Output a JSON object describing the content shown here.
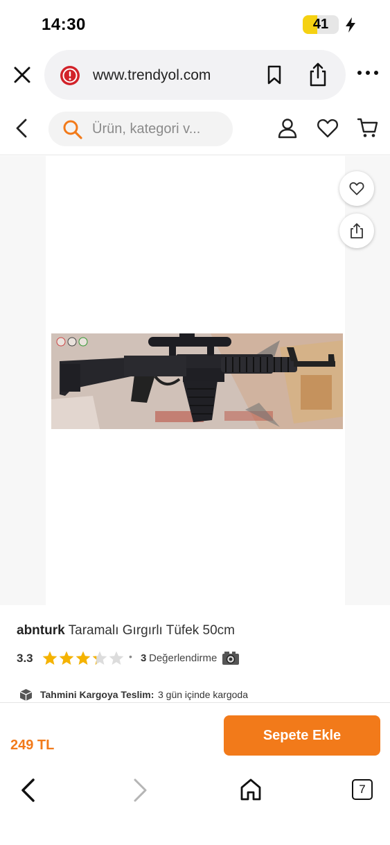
{
  "status_bar": {
    "time": "14:30",
    "battery_level": "41",
    "battery_fraction": 0.41,
    "battery_color": "#f5d112"
  },
  "browser": {
    "url": "www.trendyol.com",
    "icons": [
      "close-icon",
      "security-warning-icon",
      "bookmark-icon",
      "share-icon",
      "more-options-icon"
    ]
  },
  "site_header": {
    "search_placeholder": "Ürün, kategori v...",
    "icons": [
      "back-chevron-icon",
      "search-icon",
      "user-icon",
      "heart-icon",
      "cart-icon"
    ]
  },
  "product": {
    "brand": "abnturk",
    "name": "Taramalı Gırgırlı Tüfek 50cm",
    "rating": "3.3",
    "rating_stars_filled": 3.3,
    "rating_stars_total": 5,
    "review_count": "3",
    "review_label": "Değerlendirme",
    "delivery_label": "Tahmini Kargoya Teslim:",
    "delivery_value": "3 gün içinde kargoda",
    "price": "249 TL",
    "add_to_cart_label": "Sepete Ekle"
  },
  "bottom_nav": {
    "tab_count": "7",
    "icons": [
      "back-arrow-icon",
      "forward-arrow-icon",
      "home-icon",
      "tabs-icon"
    ]
  },
  "colors": {
    "accent": "#f27a1a",
    "star": "#f5b301",
    "warning_red": "#d2232a"
  }
}
